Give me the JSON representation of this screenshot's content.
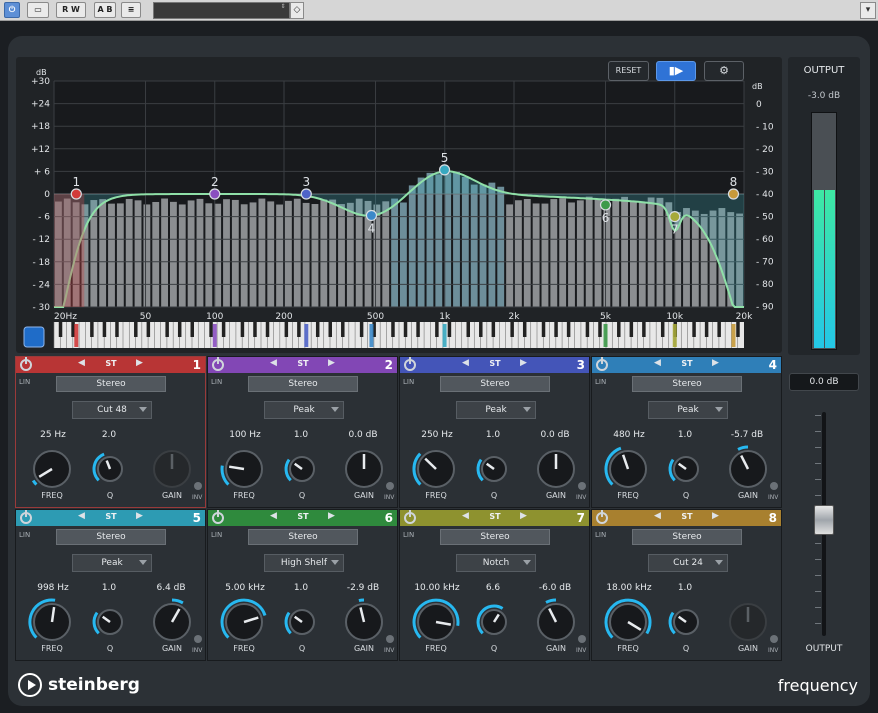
{
  "toolbar": {
    "power_label": "",
    "btn_compare": "",
    "btn_rw": "R W",
    "btn_ab": "A B",
    "btn_menu": "≡",
    "preset_value": "",
    "preset_arrows": "⇕",
    "dropdown_icon": "▾"
  },
  "graph": {
    "reset_label": "RESET",
    "listen_icon": "speaker-icon",
    "settings_icon": "gear-icon",
    "db_left_unit": "dB",
    "db_right_unit": "dB",
    "db_left_ticks": [
      "+30",
      "+24",
      "+18",
      "+12",
      "+ 6",
      "0",
      "- 6",
      "- 12",
      "- 18",
      "- 24",
      "- 30"
    ],
    "db_right_ticks": [
      "0",
      "- 10",
      "- 20",
      "- 30",
      "- 40",
      "- 50",
      "- 60",
      "- 70",
      "- 80",
      "- 90"
    ],
    "freq_ticks": [
      "20Hz",
      "50",
      "100",
      "200",
      "500",
      "1k",
      "2k",
      "5k",
      "10k",
      "20k"
    ],
    "nodes": [
      {
        "num": "1",
        "freq": 25,
        "gain": 0,
        "color": "#d23a3a"
      },
      {
        "num": "2",
        "freq": 100,
        "gain": 0,
        "color": "#8a4fc0"
      },
      {
        "num": "3",
        "freq": 250,
        "gain": 0,
        "color": "#4f63c8"
      },
      {
        "num": "4",
        "freq": 480,
        "gain": -5.7,
        "color": "#3b88c9"
      },
      {
        "num": "5",
        "freq": 998,
        "gain": 6.4,
        "color": "#37a8c0"
      },
      {
        "num": "6",
        "freq": 5000,
        "gain": -2.9,
        "color": "#3d9a4a"
      },
      {
        "num": "7",
        "freq": 10000,
        "gain": -6.0,
        "color": "#a6a93a"
      },
      {
        "num": "8",
        "freq": 18000,
        "gain": 0,
        "color": "#c79a3a"
      }
    ]
  },
  "output": {
    "title": "OUTPUT",
    "peak_db": "-3.0 dB",
    "meter_level": 0.67,
    "gain_value": "0.0 dB",
    "fader_label": "OUTPUT"
  },
  "bands": [
    {
      "num": "1",
      "color": "#b83535",
      "st": "ST",
      "lin": "LIN",
      "stereo": "Stereo",
      "type": "Cut 48",
      "freq": "25 Hz",
      "q": "2.0",
      "gain": "",
      "gain_active": false,
      "freq_pos": 0.05,
      "q_pos": 0.42,
      "gain_pos": 0.5,
      "selected": true
    },
    {
      "num": "2",
      "color": "#8247b5",
      "st": "ST",
      "lin": "LIN",
      "stereo": "Stereo",
      "type": "Peak",
      "freq": "100 Hz",
      "q": "1.0",
      "gain": "0.0 dB",
      "gain_active": true,
      "freq_pos": 0.2,
      "q_pos": 0.3,
      "gain_pos": 0.5,
      "selected": false
    },
    {
      "num": "3",
      "color": "#4455b8",
      "st": "ST",
      "lin": "LIN",
      "stereo": "Stereo",
      "type": "Peak",
      "freq": "250 Hz",
      "q": "1.0",
      "gain": "0.0 dB",
      "gain_active": true,
      "freq_pos": 0.33,
      "q_pos": 0.3,
      "gain_pos": 0.5,
      "selected": false
    },
    {
      "num": "4",
      "color": "#2f7fb8",
      "st": "ST",
      "lin": "LIN",
      "stereo": "Stereo",
      "type": "Peak",
      "freq": "480 Hz",
      "q": "1.0",
      "gain": "-5.7 dB",
      "gain_active": true,
      "freq_pos": 0.43,
      "q_pos": 0.3,
      "gain_pos": 0.4,
      "selected": false
    },
    {
      "num": "5",
      "color": "#2d9bb3",
      "st": "ST",
      "lin": "LIN",
      "stereo": "Stereo",
      "type": "Peak",
      "freq": "998 Hz",
      "q": "1.0",
      "gain": "6.4 dB",
      "gain_active": true,
      "freq_pos": 0.53,
      "q_pos": 0.3,
      "gain_pos": 0.61,
      "selected": false
    },
    {
      "num": "6",
      "color": "#2f8a3d",
      "st": "ST",
      "lin": "LIN",
      "stereo": "Stereo",
      "type": "High Shelf",
      "freq": "5.00 kHz",
      "q": "1.0",
      "gain": "-2.9 dB",
      "gain_active": true,
      "freq_pos": 0.77,
      "q_pos": 0.3,
      "gain_pos": 0.45,
      "selected": false
    },
    {
      "num": "7",
      "color": "#8e922f",
      "st": "ST",
      "lin": "LIN",
      "stereo": "Stereo",
      "type": "Notch",
      "freq": "10.00 kHz",
      "q": "6.6",
      "gain": "-6.0 dB",
      "gain_active": true,
      "freq_pos": 0.87,
      "q_pos": 0.62,
      "gain_pos": 0.4,
      "selected": false
    },
    {
      "num": "8",
      "color": "#a8802f",
      "st": "ST",
      "lin": "LIN",
      "stereo": "Stereo",
      "type": "Cut 24",
      "freq": "18.00 kHz",
      "q": "1.0",
      "gain": "",
      "gain_active": false,
      "freq_pos": 0.95,
      "q_pos": 0.3,
      "gain_pos": 0.5,
      "selected": false
    }
  ],
  "labels": {
    "freq": "FREQ",
    "q": "Q",
    "gain": "GAIN",
    "inv": "INV"
  },
  "brand": {
    "logo": "steinberg",
    "product": "frequency"
  }
}
